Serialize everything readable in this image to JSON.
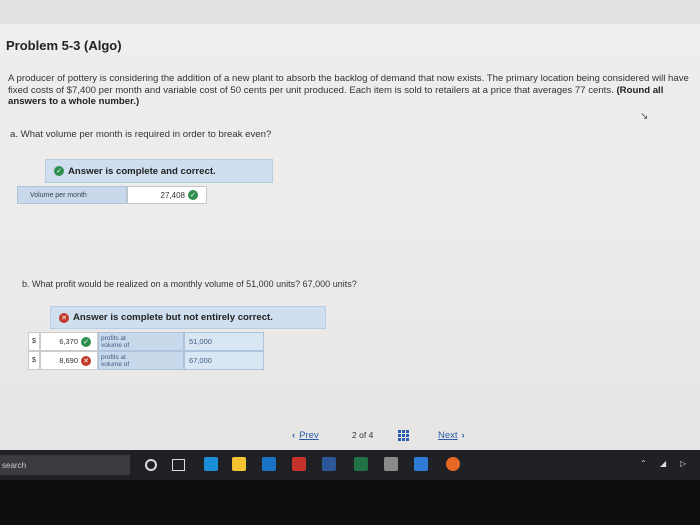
{
  "page": {
    "title": "Problem 5-3 (Algo)",
    "problem_text_1": "A producer of pottery is considering the addition of a new plant to absorb the backlog of demand that now exists. The primary location being considered will have fixed costs of $7,400 per month and variable cost of 50 cents per unit produced. Each item is sold to retailers at a price that averages 77 cents. ",
    "problem_text_bold": "(Round all answers to a whole number.)"
  },
  "part_a": {
    "question": "a. What volume per month is required in order to break even?",
    "status": "Answer is complete and correct.",
    "row_label": "Volume per month",
    "row_value": "27,408"
  },
  "part_b": {
    "question": "b. What profit would be realized on a monthly volume of 51,000 units? 67,000 units?",
    "status": "Answer is complete but not entirely correct.",
    "rows": [
      {
        "currency": "$",
        "amount": "6,370",
        "desc_1": "profits at",
        "desc_2": "volume of",
        "units": "51,000"
      },
      {
        "currency": "$",
        "amount": "8,690",
        "desc_1": "profits at",
        "desc_2": "volume of",
        "units": "67,000"
      }
    ]
  },
  "nav": {
    "prev": "Prev",
    "page_current": "2",
    "page_of": "of",
    "page_total": "4",
    "next": "Next"
  },
  "taskbar": {
    "search_label": "search"
  },
  "colors": {
    "correct": "#2f8f4e",
    "incorrect": "#c0392b",
    "link": "#2a5caa",
    "status_bg": "#cfdff0"
  }
}
